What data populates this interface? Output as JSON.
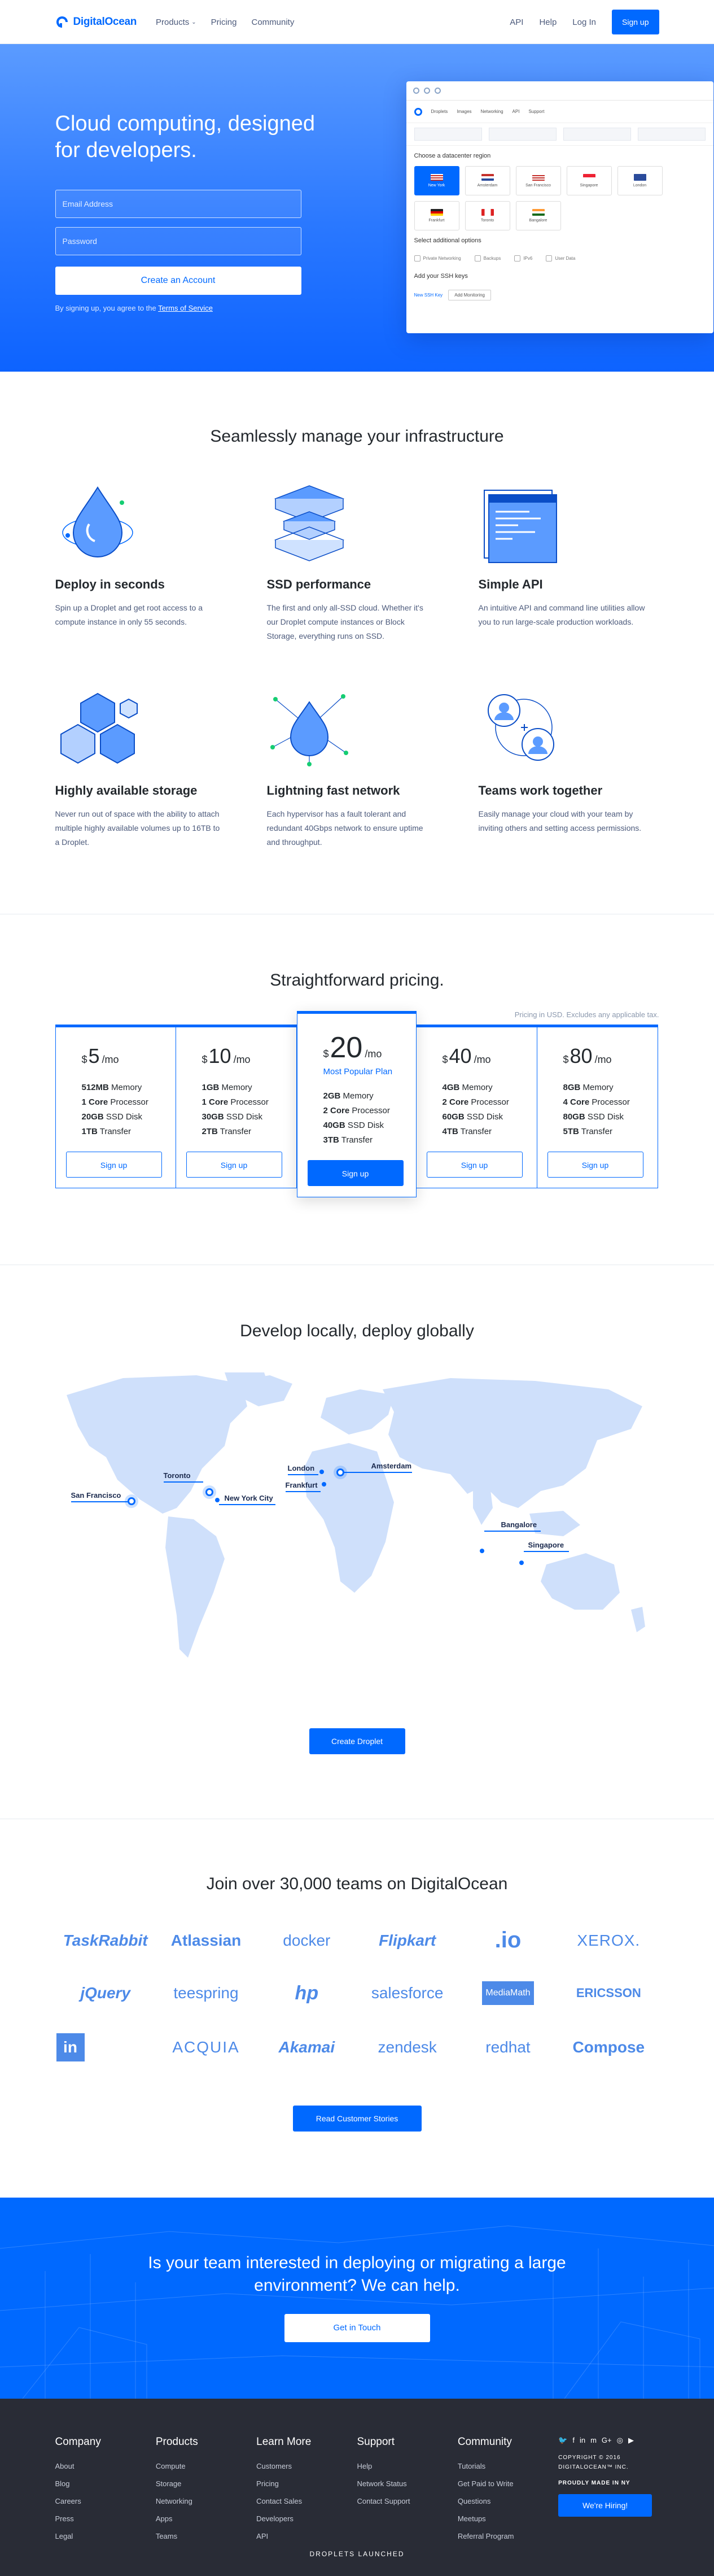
{
  "header": {
    "brand": "DigitalOcean",
    "nav_left": [
      "Products",
      "Pricing",
      "Community"
    ],
    "nav_right": [
      "API",
      "Help",
      "Log In"
    ],
    "signup": "Sign up"
  },
  "hero": {
    "title": "Cloud computing, designed for developers.",
    "email_placeholder": "Email Address",
    "password_placeholder": "Password",
    "cta": "Create an Account",
    "terms_prefix": "By signing up, you agree to the",
    "terms_link": "Terms of Service",
    "mock": {
      "tabs": [
        "Droplets",
        "Images",
        "Networking",
        "API",
        "Support"
      ],
      "region_heading": "Choose a datacenter region",
      "regions": [
        "New York",
        "Amsterdam",
        "San Francisco",
        "Singapore",
        "London",
        "Frankfurt",
        "Toronto",
        "Bangalore"
      ],
      "options_heading": "Select additional options",
      "options": [
        "Private Networking",
        "Backups",
        "IPv6",
        "User Data"
      ],
      "ssh_heading": "Add your SSH keys",
      "ssh_new": "New SSH Key",
      "ssh_btn": "Add Monitoring"
    }
  },
  "features": {
    "title": "Seamlessly manage your infrastructure",
    "items": [
      {
        "icon": "droplet-icon",
        "title": "Deploy in seconds",
        "text": "Spin up a Droplet and get root access to a compute instance in only 55 seconds."
      },
      {
        "icon": "ssd-icon",
        "title": "SSD performance",
        "text": "The first and only all-SSD cloud. Whether it's our Droplet compute instances or Block Storage, everything runs on SSD."
      },
      {
        "icon": "api-icon",
        "title": "Simple API",
        "text": "An intuitive API and command line utilities allow you to run large-scale production workloads."
      },
      {
        "icon": "storage-icon",
        "title": "Highly available storage",
        "text": "Never run out of space with the ability to attach multiple highly available volumes up to 16TB to a Droplet."
      },
      {
        "icon": "network-icon",
        "title": "Lightning fast network",
        "text": "Each hypervisor has a fault tolerant and redundant 40Gbps network to ensure uptime and throughput."
      },
      {
        "icon": "team-icon",
        "title": "Teams work together",
        "text": "Easily manage your cloud with your team by inviting others and setting access permissions."
      }
    ]
  },
  "pricing": {
    "title": "Straightforward pricing.",
    "note": "Pricing in USD. Excludes any applicable tax.",
    "plans": [
      {
        "price": "5",
        "unit": "/mo",
        "popular": "",
        "specs": [
          [
            "512MB",
            " Memory"
          ],
          [
            "1 Core",
            " Processor"
          ],
          [
            "20GB",
            " SSD Disk"
          ],
          [
            "1TB",
            " Transfer"
          ]
        ],
        "btn": "Sign up"
      },
      {
        "price": "10",
        "unit": "/mo",
        "popular": "",
        "specs": [
          [
            "1GB",
            " Memory"
          ],
          [
            "1 Core",
            " Processor"
          ],
          [
            "30GB",
            " SSD Disk"
          ],
          [
            "2TB",
            " Transfer"
          ]
        ],
        "btn": "Sign up"
      },
      {
        "price": "20",
        "unit": "/mo",
        "popular": "Most Popular Plan",
        "specs": [
          [
            "2GB",
            " Memory"
          ],
          [
            "2 Core",
            " Processor"
          ],
          [
            "40GB",
            " SSD Disk"
          ],
          [
            "3TB",
            " Transfer"
          ]
        ],
        "btn": "Sign up"
      },
      {
        "price": "40",
        "unit": "/mo",
        "popular": "",
        "specs": [
          [
            "4GB",
            " Memory"
          ],
          [
            "2 Core",
            " Processor"
          ],
          [
            "60GB",
            " SSD Disk"
          ],
          [
            "4TB",
            " Transfer"
          ]
        ],
        "btn": "Sign up"
      },
      {
        "price": "80",
        "unit": "/mo",
        "popular": "",
        "specs": [
          [
            "8GB",
            " Memory"
          ],
          [
            "4 Core",
            " Processor"
          ],
          [
            "80GB",
            " SSD Disk"
          ],
          [
            "5TB",
            " Transfer"
          ]
        ],
        "btn": "Sign up"
      }
    ]
  },
  "map": {
    "title": "Develop locally, deploy globally",
    "cities": [
      "San Francisco",
      "Toronto",
      "New York City",
      "London",
      "Amsterdam",
      "Frankfurt",
      "Bangalore",
      "Singapore"
    ],
    "cta": "Create Droplet"
  },
  "customers": {
    "title": "Join over 30,000 teams on DigitalOcean",
    "logos": [
      "TaskRabbit",
      "Atlassian",
      "docker",
      "Flipkart",
      ".io",
      "XEROX.",
      "jQuery",
      "teespring",
      "hp",
      "salesforce",
      "MediaMath",
      "ERICSSON",
      "in",
      "ACQUIA",
      "Akamai",
      "zendesk",
      "redhat",
      "Compose"
    ],
    "cta": "Read Customer Stories"
  },
  "cta_band": {
    "title": "Is your team interested in deploying or migrating a large environment? We can help.",
    "btn": "Get in Touch"
  },
  "footer": {
    "columns": [
      {
        "title": "Company",
        "links": [
          "About",
          "Blog",
          "Careers",
          "Press",
          "Legal"
        ]
      },
      {
        "title": "Products",
        "links": [
          "Compute",
          "Storage",
          "Networking",
          "Apps",
          "Teams"
        ]
      },
      {
        "title": "Learn More",
        "links": [
          "Customers",
          "Pricing",
          "Contact Sales",
          "Developers",
          "API"
        ]
      },
      {
        "title": "Support",
        "links": [
          "Help",
          "Network Status",
          "Contact Support"
        ]
      },
      {
        "title": "Community",
        "links": [
          "Tutorials",
          "Get Paid to Write",
          "Questions",
          "Meetups",
          "Referral Program"
        ]
      }
    ],
    "copyright": "COPYRIGHT © 2016 DIGITALOCEAN™ INC.",
    "made_in": "PROUDLY MADE IN NY",
    "hiring": "We're Hiring!",
    "droplets": "DROPLETS LAUNCHED"
  }
}
